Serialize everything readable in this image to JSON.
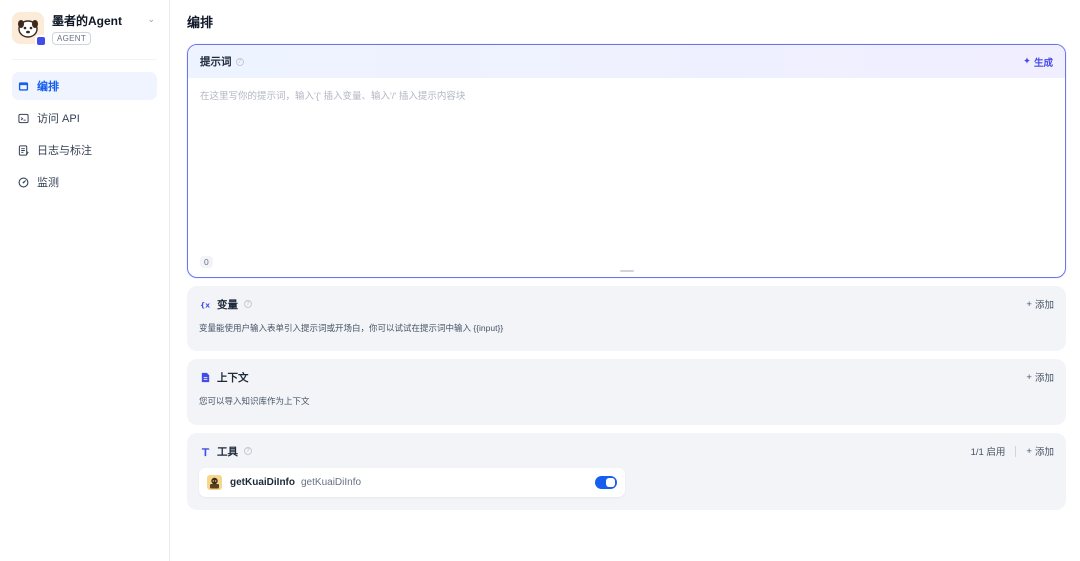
{
  "sidebar": {
    "agent_name": "墨者的Agent",
    "agent_tag": "AGENT",
    "items": [
      {
        "label": "编排",
        "icon": "layout-icon",
        "active": true
      },
      {
        "label": "访问 API",
        "icon": "terminal-icon",
        "active": false
      },
      {
        "label": "日志与标注",
        "icon": "document-icon",
        "active": false
      },
      {
        "label": "监测",
        "icon": "gauge-icon",
        "active": false
      }
    ]
  },
  "main": {
    "page_title": "编排",
    "prompt": {
      "title": "提示词",
      "generate_label": "生成",
      "placeholder": "在这里写你的提示词，输入'{' 插入变量、输入'/' 插入提示内容块",
      "value": "",
      "char_count": "0"
    },
    "variables": {
      "title": "变量",
      "add_label": "添加",
      "description": "变量能使用户输入表单引入提示词或开场白，你可以试试在提示词中输入 {{input}}"
    },
    "context": {
      "title": "上下文",
      "add_label": "添加",
      "description": "您可以导入知识库作为上下文"
    },
    "tools": {
      "title": "工具",
      "enabled_count": "1/1 启用",
      "add_label": "添加",
      "items": [
        {
          "name": "getKuaiDiInfo",
          "subtitle": "getKuaiDiInfo",
          "enabled": true
        }
      ]
    }
  },
  "colors": {
    "accent": "#155eef",
    "prompt_border": "#6b75f0",
    "generate": "#444ce7",
    "section_bg": "#f2f4f7"
  }
}
